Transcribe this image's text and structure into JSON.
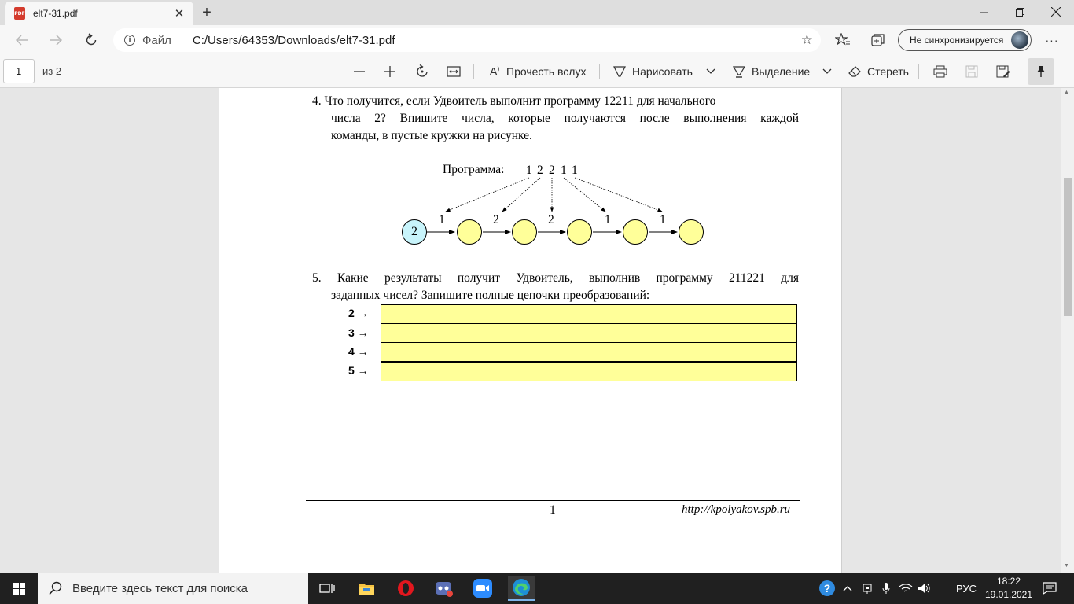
{
  "browser": {
    "tab_title": "elt7-31.pdf",
    "pdf_icon_text": "PDF",
    "address_label": "Файл",
    "url": "C:/Users/64353/Downloads/elt7-31.pdf",
    "sync_label": "Не синхронизируется"
  },
  "pdf_toolbar": {
    "page_number": "1",
    "page_total": "из 2",
    "read_aloud": "Прочесть вслух",
    "draw": "Нарисовать",
    "highlight": "Выделение",
    "erase": "Стереть"
  },
  "document": {
    "q4": {
      "lines": [
        "4. Что получится, если Удвоитель выполнит программу 12211 для начального",
        "числа 2? Впишите числа, которые получаются после выполнения каждой",
        "команды, в пустые кружки на рисунке."
      ],
      "program_label": "Программа:",
      "program_digits": [
        "1",
        "2",
        "2",
        "1",
        "1"
      ],
      "start_value": "2",
      "edge_labels": [
        "1",
        "2",
        "2",
        "1",
        "1"
      ]
    },
    "q5": {
      "lines": [
        "5. Какие результаты получит Удвоитель, выполнив программу 211221 для",
        "заданных чисел? Запишите полные цепочки преобразований:"
      ],
      "rows": [
        "2 →",
        "3 →",
        "4 →",
        "5 →"
      ]
    },
    "footer": {
      "page_number": "1",
      "url": "http://kpolyakov.spb.ru"
    }
  },
  "taskbar": {
    "search_placeholder": "Введите здесь текст для поиска",
    "language": "РУС",
    "time": "18:22",
    "date": "19.01.2021"
  },
  "colors": {
    "start_circle": "#c8f4fb",
    "empty_circle": "#ffff99",
    "answer_cell": "#ffff99"
  }
}
